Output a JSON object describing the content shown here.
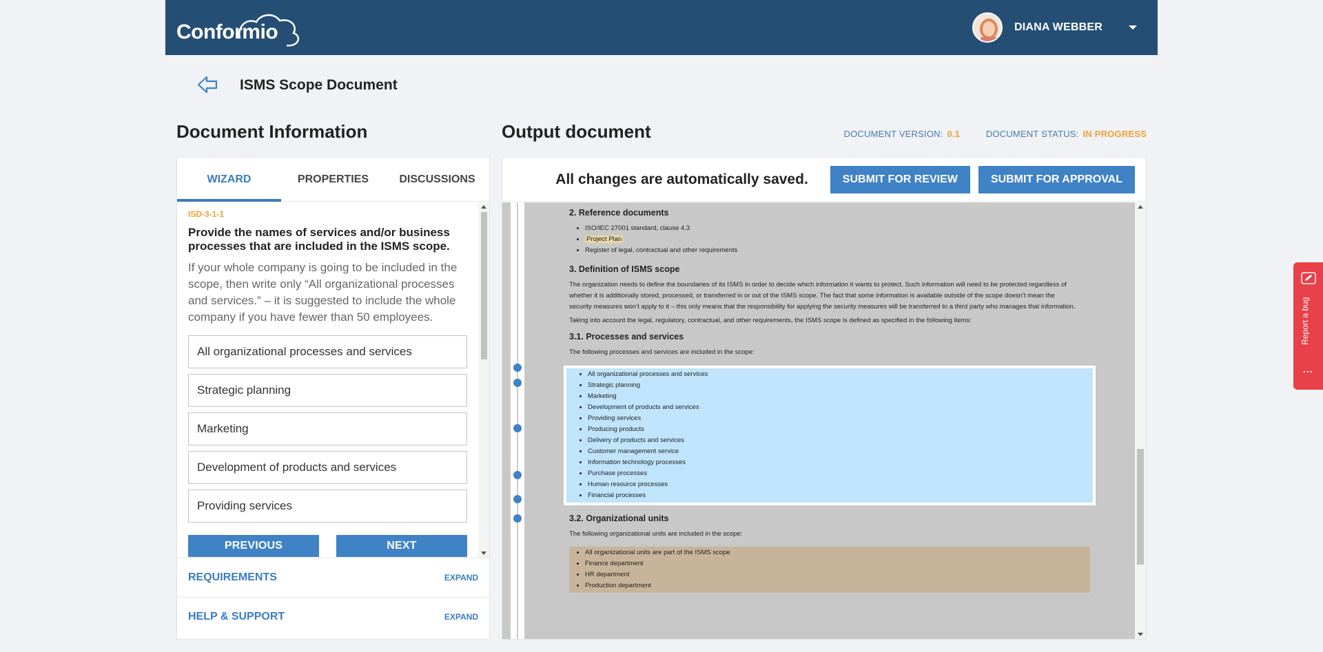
{
  "header": {
    "logo_text": "Conformio",
    "user_name": "DIANA WEBBER"
  },
  "page": {
    "title": "ISMS Scope Document"
  },
  "left": {
    "section_title": "Document Information",
    "tabs": [
      {
        "label": "WIZARD"
      },
      {
        "label": "PROPERTIES"
      },
      {
        "label": "DISCUSSIONS"
      }
    ],
    "question_id": "ISD-3-1-1",
    "question_title": "Provide the names of services and/or business processes that are included in the ISMS scope.",
    "question_help": "If your whole company is going to be included in the scope, then write only “All organizational processes and services.” – it is suggested to include the whole company if you have fewer than 50 employees.",
    "answers": [
      "All organizational processes and services",
      "Strategic planning",
      "Marketing",
      "Development of products and services",
      "Providing services"
    ],
    "prev_label": "PREVIOUS",
    "next_label": "NEXT",
    "requirements_label": "REQUIREMENTS",
    "help_label": "HELP & SUPPORT",
    "expand_label": "EXPAND"
  },
  "right": {
    "section_title": "Output document",
    "version_label": "DOCUMENT VERSION:",
    "version_value": "0.1",
    "status_label": "DOCUMENT STATUS:",
    "status_value": "IN PROGRESS",
    "saved_text": "All changes are automatically saved.",
    "submit_review": "SUBMIT FOR REVIEW",
    "submit_approval": "SUBMIT FOR APPROVAL"
  },
  "doc": {
    "h_ref": "2. Reference documents",
    "ref_items": [
      "ISO/IEC 27001 standard, clause 4.3",
      "Project Plan",
      "Register of legal, contractual and other requirements"
    ],
    "h_def": "3. Definition of ISMS scope",
    "p_def1": "The organization needs to define the boundaries of its ISMS in order to decide which information it wants to protect. Such information will need to be protected regardless of whether it is additionally stored, processed, or transferred in or out of the ISMS scope. The fact that some information is available outside of the scope doesn’t mean the security measures won’t apply to it – this only means that the responsibility for applying the security measures will be transferred to a third party who manages that information.",
    "p_def2": "Taking into account the legal, regulatory, contractual, and other requirements, the ISMS scope is defined as specified in the following items:",
    "h_proc": "3.1. Processes and services",
    "p_proc": "The following processes and services are included in the scope:",
    "proc_items": [
      "All organizational processes and services",
      "Strategic planning",
      "Marketing",
      "Development of products and services",
      "Providing services",
      "Producing products",
      "Delivery of products and services",
      "Customer management service",
      "Information technology processes",
      "Purchase processes",
      "Human resource processes",
      "Financial processes"
    ],
    "h_units": "3.2. Organizational units",
    "p_units": "The following organizational units are included in the scope:",
    "unit_items": [
      "All organizational units are part of the ISMS scope",
      "Finance department",
      "HR department",
      "Production department"
    ]
  },
  "report_bug": {
    "label": "Report a bug",
    "dots": "..."
  },
  "colors": {
    "header_bg": "#244e74",
    "accent_blue": "#3f82c6",
    "accent_orange": "#f0a030",
    "bug_red": "#e8414a",
    "highlight_blue": "#bfe4fb",
    "highlight_tan": "#c8b49a"
  }
}
